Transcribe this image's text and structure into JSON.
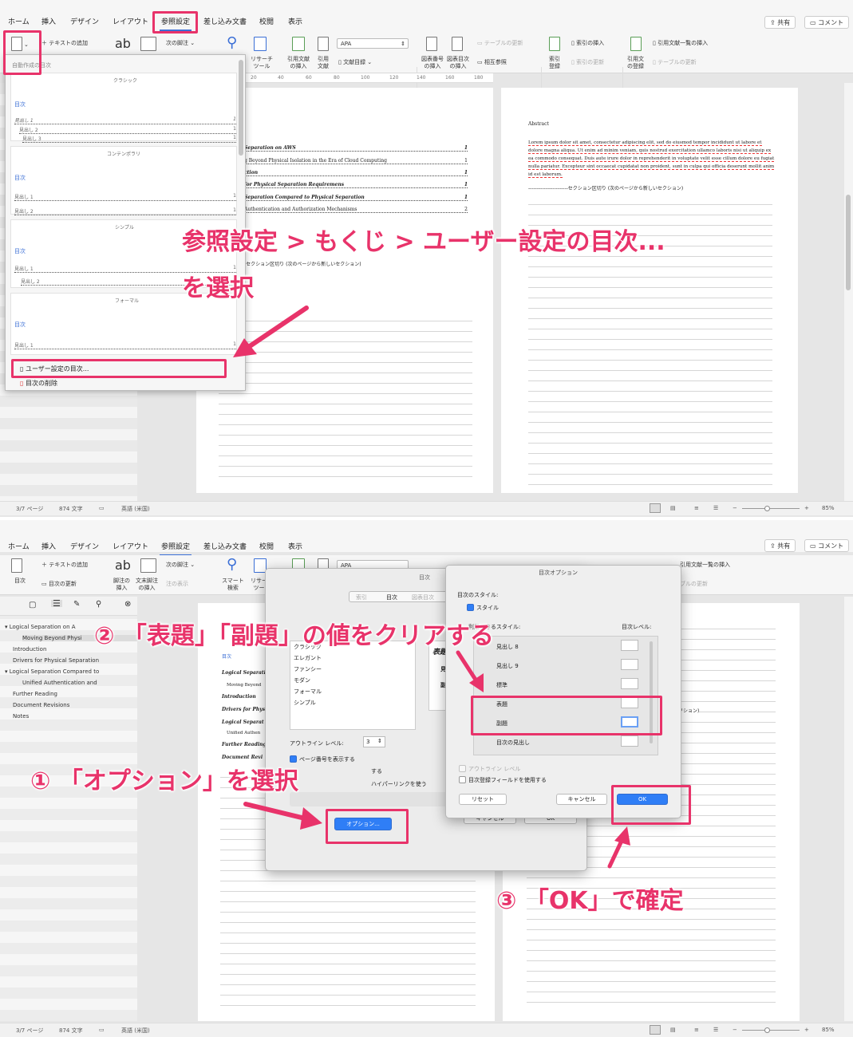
{
  "top": {
    "tabs": [
      "ホーム",
      "挿入",
      "デザイン",
      "レイアウト",
      "参照設定",
      "差し込み文書",
      "校閲",
      "表示"
    ],
    "share_label": "共有",
    "comment_label": "コメント",
    "ribbon": {
      "add_text": "テキストの追加",
      "next_footnote": "次の脚注",
      "research_tool": "リサーチ\nツール",
      "insert_citation": "引用文献\nの挿入",
      "citation": "引用\n文献",
      "style_value": "APA",
      "bibliography": "文献目録",
      "insert_caption": "図表番号\nの挿入",
      "insert_toc_figures": "図表目次\nの挿入",
      "update_table": "テーブルの更新",
      "cross_ref": "相互参照",
      "mark_entry": "索引\n登録",
      "insert_index": "索引の挿入",
      "update_index": "索引の更新",
      "mark_citation": "引用文\nの登録",
      "insert_toa": "引用文献一覧の挿入",
      "update_table2": "テーブルの更新"
    },
    "ruler_labels": [
      "20",
      "40",
      "60",
      "80",
      "100",
      "120",
      "140",
      "160",
      "180"
    ],
    "dropdown": {
      "header": "自動作成の目次",
      "sections": [
        {
          "name": "クラシック",
          "toc": "目次",
          "lines": [
            "見出し 1",
            "見出し 2",
            "見出し 3"
          ],
          "pages": [
            "1",
            "1",
            "1"
          ]
        },
        {
          "name": "コンテンポラリ",
          "toc": "目次",
          "lines": [
            "見出し 1",
            "見出し 2"
          ],
          "pages": [
            "1",
            "1"
          ]
        },
        {
          "name": "シンプル",
          "toc": "目次",
          "lines": [
            "見出し 1",
            "見出し 2"
          ],
          "pages": [
            "1",
            "1"
          ]
        },
        {
          "name": "フォーマル",
          "toc": "目次",
          "lines": [
            "見出し 1"
          ],
          "pages": [
            "1"
          ]
        }
      ],
      "custom": "ユーザー設定の目次...",
      "remove": "目次の削除"
    },
    "doc_left": [
      "Separation on AWS",
      "g Beyond Physical Isolation in the Era of Cloud Computing",
      "ction",
      "for Physical Separation Requiremens",
      "Separation Compared to Physical Separation",
      "Authentication and Authorization Mechanisms",
      "-セクション区切り (次のページから新しいセクション)"
    ],
    "doc_left_pages": [
      "1",
      "1",
      "1",
      "1",
      "1",
      "2"
    ],
    "doc_right": {
      "abstract": "Abstract",
      "lorem": [
        "Lorem ipsum dolor sit amet, consectetur adipiscing elit, sed do eiusmod tempor incididunt ut labore et",
        "dolore magna aliqua. Ut enim ad minim veniam, quis nostrud exercitation ullamco laboris nisi ut aliquip ex",
        "ea commodo consequat. Duis aute irure dolor in reprehenderit in voluptate velit esse cillum dolore eu fugiat",
        "nulla pariatur. Excepteur sint occaecat cupidatat non proident, sunt in culpa qui officia deserunt mollit anim",
        "id est laborum."
      ],
      "section_break": "セクション区切り (次のページから新しいセクション)"
    },
    "status": {
      "page": "3/7 ページ",
      "words": "874 文字",
      "lang": "英語 (米国)",
      "zoom": "85%"
    },
    "annotation": {
      "line1": "参照設定 > もくじ > ユーザー設定の目次...",
      "line2": "を選択"
    }
  },
  "bottom": {
    "tabs": [
      "ホーム",
      "挿入",
      "デザイン",
      "レイアウト",
      "参照設定",
      "差し込み文書",
      "校閲",
      "表示"
    ],
    "share_label": "共有",
    "comment_label": "コメント",
    "ribbon": {
      "toc": "目次",
      "update_toc": "目次の更新",
      "add_text": "テキストの追加",
      "insert_footnote": "脚注の\n挿入",
      "insert_endnote": "文末脚注\nの挿入",
      "next_footnote": "次の脚注",
      "show_notes": "注の表示",
      "smart_lookup": "スマート\n検索",
      "research": "リサー\nツー",
      "style_value": "APA",
      "insert_toa": "引用文献一覧の挿入",
      "update_table": "ブルの更新"
    },
    "nav_items": [
      "Logical Separation on A",
      "Moving Beyond Physi",
      "Introduction",
      "Drivers for Physical Separation",
      "Logical Separation Compared to",
      "Unified Authentication and",
      "Further Reading",
      "Document Revisions",
      "Notes"
    ],
    "doc_left": [
      "目次",
      "Logical Separati",
      "Moving Beyond",
      "Introduction",
      "Drivers for Phys",
      "Logical Separat",
      "Unified Authen",
      "Further Reading",
      "Document Revi"
    ],
    "toc_dialog": {
      "title": "目次",
      "tabs": [
        "索引",
        "目次",
        "図表目次"
      ],
      "formats": [
        "クラシック",
        "エレガント",
        "ファンシー",
        "モダン",
        "フォーマル",
        "シンプル"
      ],
      "preview": [
        "表題",
        "見",
        "副"
      ],
      "outline_label": "アウトライン レベル:",
      "outline_value": "3",
      "show_page": "ページ番号を表示する",
      "hyperlink_suffix": "する",
      "hyperlink": "ハイパーリンクを使う",
      "options_button": "オプション...",
      "cancel": "キャンセル",
      "ok": "OK"
    },
    "options_dialog": {
      "title": "目次オプション",
      "build_from": "目次のスタイル:",
      "styles_check": "スタイル",
      "available": "利用できるスタイル:",
      "toc_level": "目次レベル:",
      "rows": [
        "見出し 8",
        "見出し 9",
        "標準",
        "表題",
        "副題",
        "目次の見出し"
      ],
      "outline_level": "アウトライン レベル",
      "fields": "目次登録フィールドを使用する",
      "reset": "リセット",
      "cancel": "キャンセル",
      "ok": "OK"
    },
    "doc_right": {
      "section_break": "ら新しいセクション)"
    },
    "status": {
      "page": "3/7 ページ",
      "words": "874 文字",
      "lang": "英語 (米国)",
      "zoom": "85%"
    },
    "annotations": {
      "step1": "① 「オプション」を選択",
      "step2": "② 「表題」「副題」の値をクリアする",
      "step3": "③ 「OK」で確定"
    }
  },
  "colors": {
    "accent": "#e8336a",
    "blue": "#2f7ef6"
  }
}
